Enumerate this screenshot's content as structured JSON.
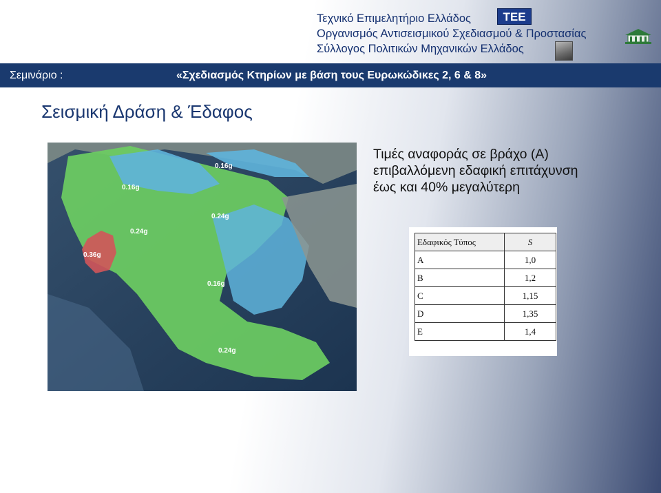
{
  "header": {
    "org_lines": [
      "Τεχνικό Επιμελητήριο Ελλάδος",
      "Οργανισμός Αντισεισμικού Σχεδιασμού & Προστασίας",
      "Σύλλογος Πολιτικών Μηχανικών Ελλάδος"
    ],
    "tee_logo_text": "TEE",
    "oasp_logo_icon": "oasp-building-logo",
    "portrait_icon": "portrait-photo"
  },
  "banner": {
    "label": "Σεμινάριο :",
    "title": "«Σχεδιασμός Κτηρίων με βάση τους Ευρωκώδικες 2, 6 & 8»"
  },
  "slide": {
    "title": "Σεισμική Δράση & Έδαφος",
    "bullets": [
      "Τιμές αναφοράς σε βράχο (Α)",
      "επιβαλλόμενη εδαφική επιτάχυνση",
      "έως και 40% μεγαλύτερη"
    ]
  },
  "map": {
    "zone_labels": [
      "0.16g",
      "0.16g",
      "0.24g",
      "0.24g",
      "0.36g",
      "0.16g",
      "0.24g"
    ]
  },
  "soil_table": {
    "headers": [
      "Εδαφικός Τύπος",
      "S"
    ],
    "rows": [
      {
        "type": "A",
        "s": "1,0"
      },
      {
        "type": "B",
        "s": "1,2"
      },
      {
        "type": "C",
        "s": "1,15"
      },
      {
        "type": "D",
        "s": "1,35"
      },
      {
        "type": "E",
        "s": "1,4"
      }
    ]
  },
  "colors": {
    "banner": "#1a3a6e",
    "header_text": "#143070",
    "zone_low": "#5fb4dc",
    "zone_mid": "#6ccd62",
    "zone_high": "#d2555a",
    "sea": "#243c58"
  }
}
